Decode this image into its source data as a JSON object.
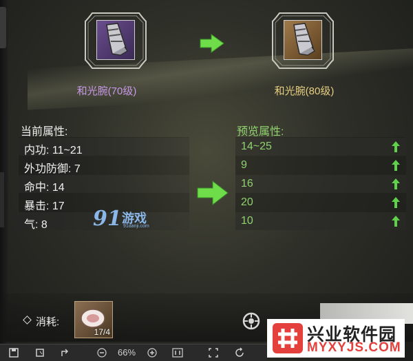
{
  "upgrade": {
    "from_item": {
      "name": "和光腕(70级)",
      "icon": "bracer-icon",
      "rarity_color": "#c799e6"
    },
    "to_item": {
      "name": "和光腕(80级)",
      "icon": "bracer-icon",
      "rarity_color": "#e7cf82"
    }
  },
  "current_attributes": {
    "title": "当前属性:",
    "rows": [
      {
        "label": "内功: 11~21"
      },
      {
        "label": "外功防御: 7"
      },
      {
        "label": "命中: 14"
      },
      {
        "label": "暴击: 17"
      },
      {
        "label": "气: 8"
      }
    ]
  },
  "preview_attributes": {
    "title": "预览属性:",
    "rows": [
      {
        "value": "14~25",
        "trend": "up"
      },
      {
        "value": "9",
        "trend": "up"
      },
      {
        "value": "16",
        "trend": "up"
      },
      {
        "value": "20",
        "trend": "up"
      },
      {
        "value": "10",
        "trend": "up"
      }
    ]
  },
  "cost": {
    "label": "消耗:",
    "item_icon": "stone-icon",
    "count": "17/4"
  },
  "watermark": {
    "brand": "91",
    "text": "游戏",
    "sub": "91danji.com"
  },
  "site_logo": {
    "cn": "兴业软件园",
    "en": "MYXYJS.COM"
  },
  "toolbar": {
    "zoom": "66%"
  },
  "colors": {
    "accent_green": "#8fd36f",
    "arrow_green": "#6fdc4a",
    "logo_red": "#e4413c"
  }
}
